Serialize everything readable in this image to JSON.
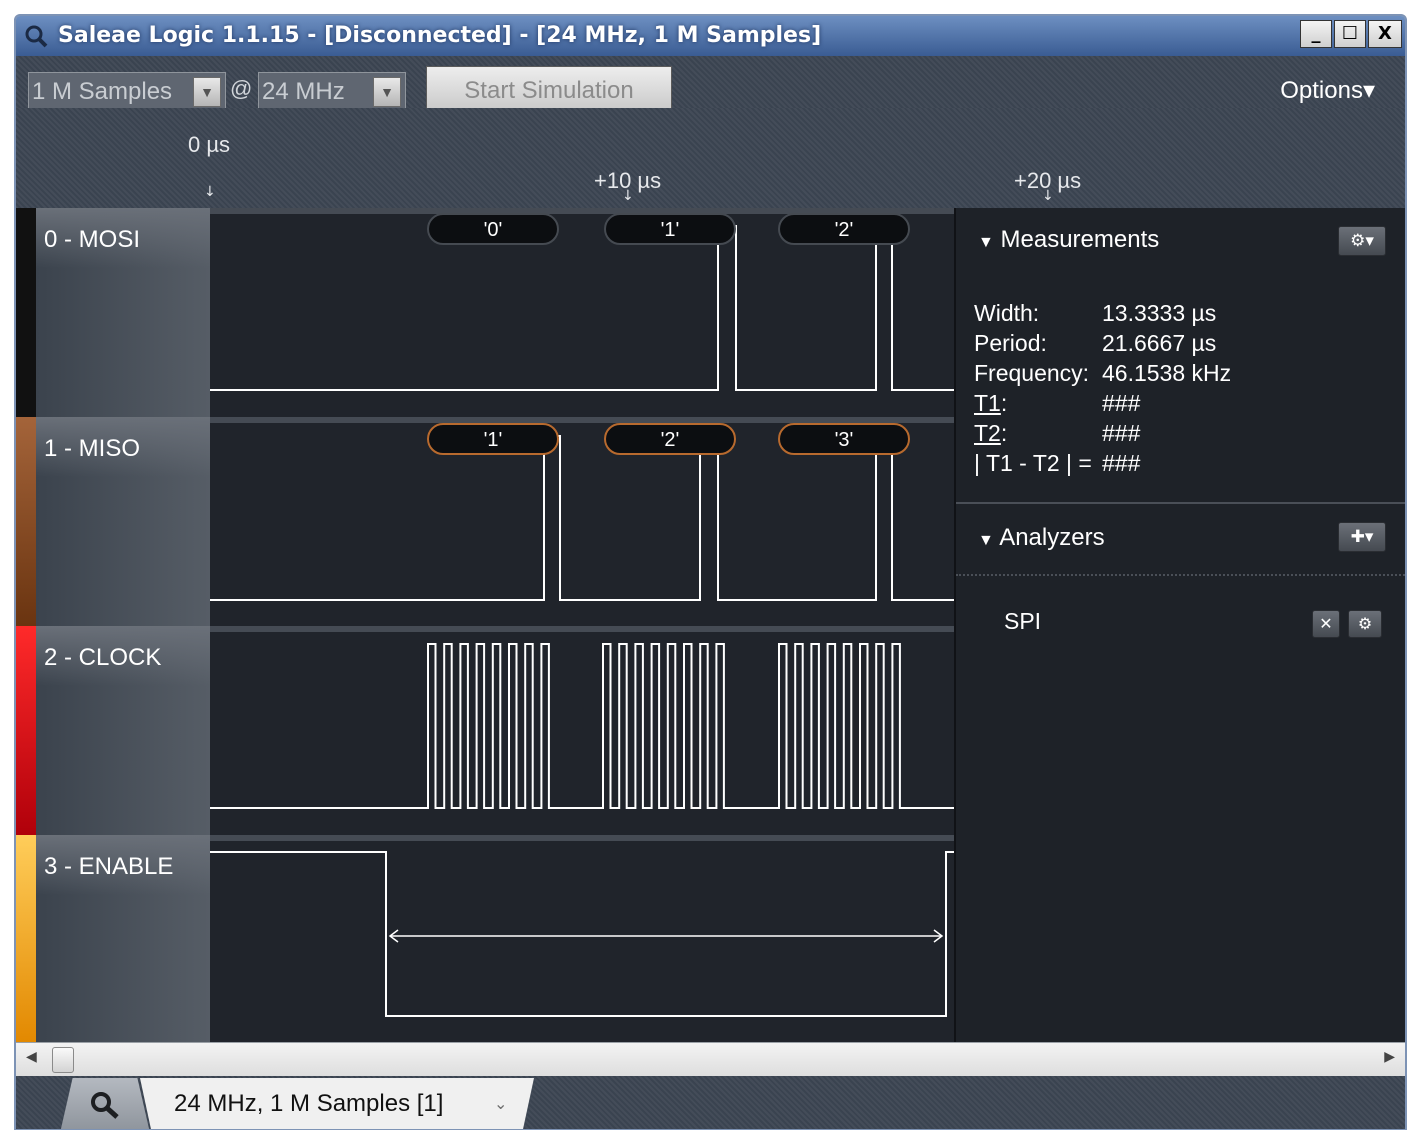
{
  "window": {
    "title": "Saleae Logic 1.1.15 - [Disconnected] - [24 MHz, 1 M Samples]",
    "controls": {
      "minimize": "_",
      "maximize": "☐",
      "close": "X"
    }
  },
  "toolbar": {
    "samples_value": "1 M Samples",
    "at": "@",
    "rate_value": "24 MHz",
    "start_button": "Start Simulation",
    "options": "Options▾"
  },
  "timeline": {
    "origin": "0 µs",
    "mark_1": "+10 µs",
    "mark_2": "+20 µs"
  },
  "channels": [
    {
      "name": "0 - MOSI",
      "color": "#111111"
    },
    {
      "name": "1 - MISO",
      "color": "#8b4a1c"
    },
    {
      "name": "2 - CLOCK",
      "color": "#e3121b"
    },
    {
      "name": "3 - ENABLE",
      "color": "#f5a60f"
    }
  ],
  "decoded": {
    "mosi": [
      "'0'",
      "'1'",
      "'2'"
    ],
    "miso": [
      "'1'",
      "'2'",
      "'3'"
    ]
  },
  "measurements": {
    "title": "Measurements",
    "width_label": "Width:",
    "width_value": "13.3333 µs",
    "period_label": "Period:",
    "period_value": "21.6667 µs",
    "freq_label": "Frequency:",
    "freq_value": "46.1538 kHz",
    "t1_label": "T1",
    "t1_colon": ":",
    "t1_value": "###",
    "t2_label": "T2",
    "t2_colon": ":",
    "t2_value": "###",
    "diff_label": "| T1 - T2 | =",
    "diff_value": "###"
  },
  "analyzers": {
    "title": "Analyzers",
    "items": [
      {
        "name": "SPI"
      }
    ]
  },
  "tab": {
    "label": "24 MHz, 1 M Samples [1]"
  }
}
